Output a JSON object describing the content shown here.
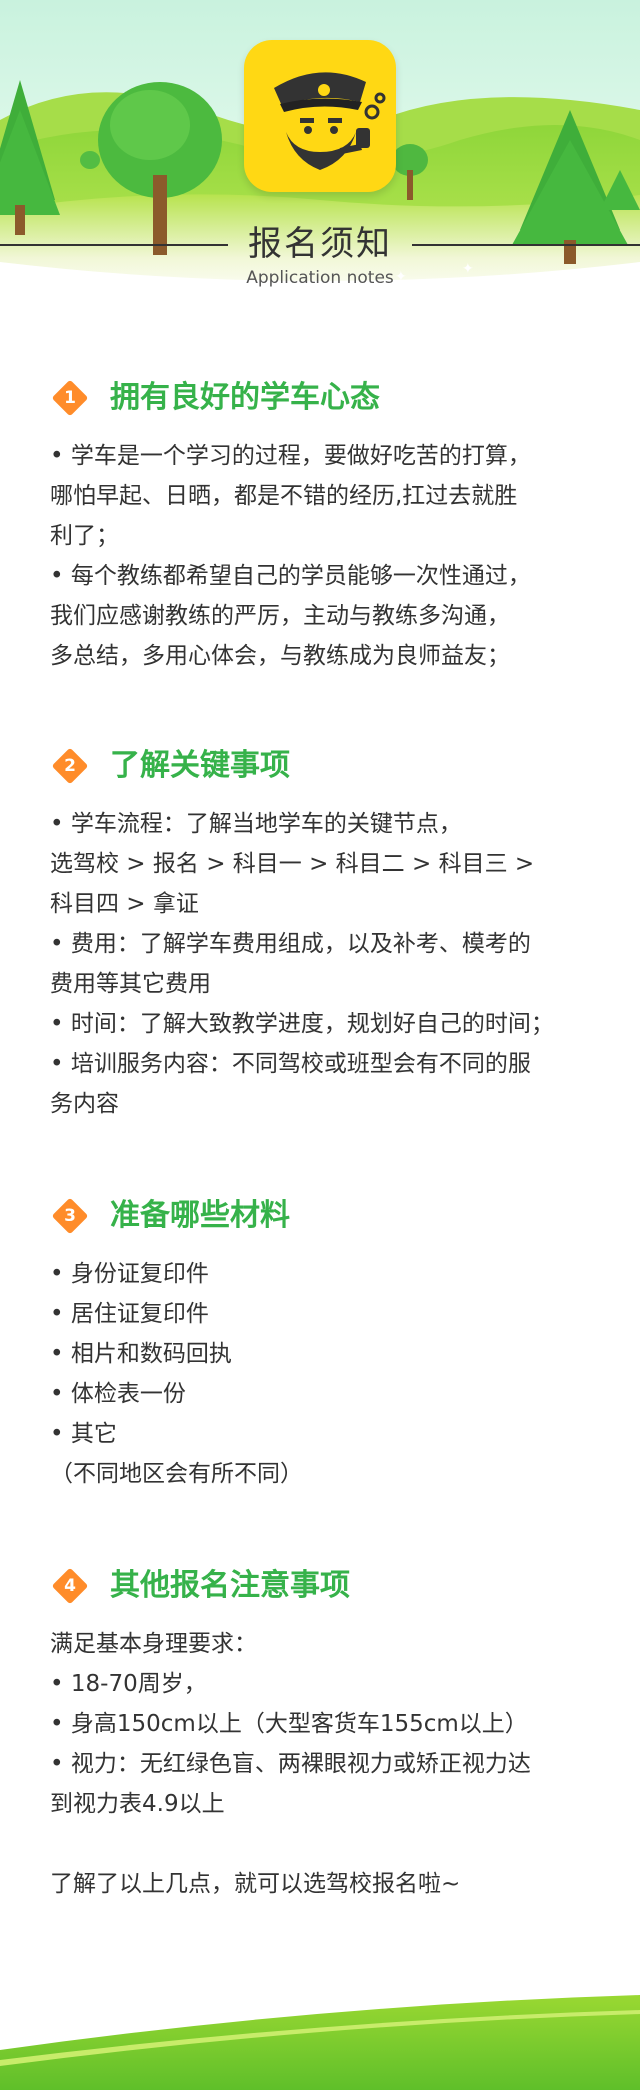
{
  "header": {
    "title": "报名须知",
    "subtitle": "Application notes"
  },
  "icons": {
    "logo": "captain-mascot-icon",
    "badge": "diamond-number-badge-icon"
  },
  "colors": {
    "accent_green": "#36b24a",
    "badge_orange": "#ff8c2a",
    "logo_yellow": "#ffd814",
    "text": "#333333"
  },
  "sections": [
    {
      "number": "1",
      "title": "拥有良好的学车心态",
      "lines": [
        "• 学车是一个学习的过程，要做好吃苦的打算，",
        "哪怕早起、日晒，都是不错的经历,扛过去就胜",
        "利了；",
        "• 每个教练都希望自己的学员能够一次性通过，",
        "我们应感谢教练的严厉，主动与教练多沟通，",
        "多总结，多用心体会，与教练成为良师益友；"
      ]
    },
    {
      "number": "2",
      "title": "了解关键事项",
      "lines": [
        "• 学车流程：了解当地学车的关键节点，",
        "选驾校 > 报名 > 科目一 > 科目二 > 科目三 >",
        "科目四 > 拿证",
        "• 费用：了解学车费用组成，以及补考、模考的",
        "费用等其它费用",
        "• 时间：了解大致教学进度，规划好自己的时间；",
        "• 培训服务内容：不同驾校或班型会有不同的服",
        "务内容"
      ]
    },
    {
      "number": "3",
      "title": "准备哪些材料",
      "lines": [
        "• 身份证复印件",
        "• 居住证复印件",
        "• 相片和数码回执",
        "• 体检表一份",
        "• 其它",
        "（不同地区会有所不同）"
      ]
    },
    {
      "number": "4",
      "title": "其他报名注意事项",
      "lines": [
        "满足基本身理要求：",
        "• 18-70周岁，",
        "• 身高150cm以上（大型客货车155cm以上）",
        "• 视力：无红绿色盲、两裸眼视力或矫正视力达",
        "到视力表4.9以上",
        "",
        "了解了以上几点，就可以选驾校报名啦~"
      ]
    }
  ]
}
